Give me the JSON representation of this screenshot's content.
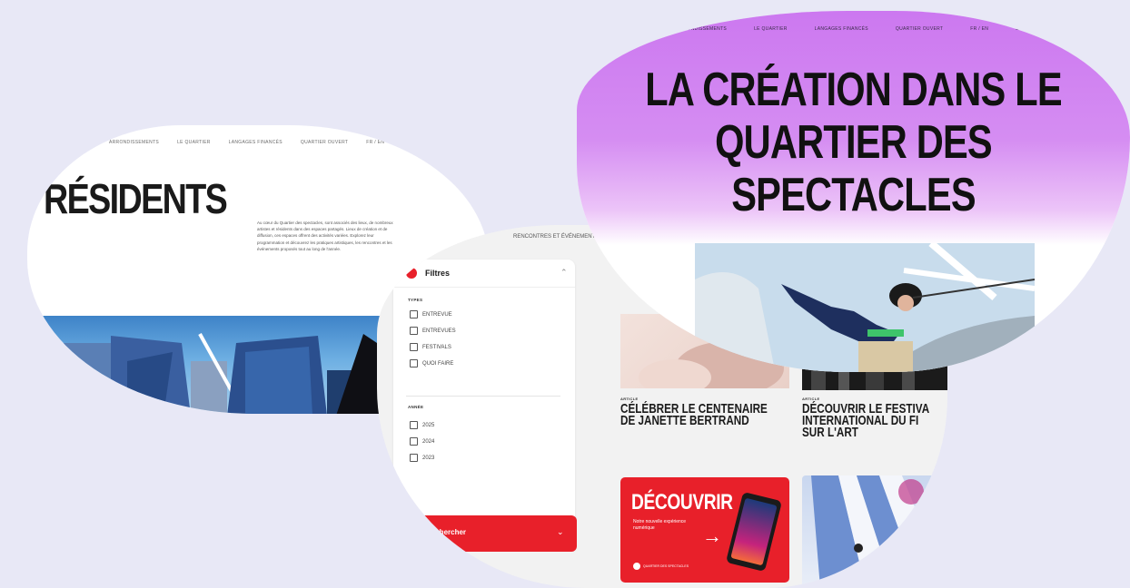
{
  "background_color": "#e8e8f6",
  "accent_color": "#e8202a",
  "hero_gradient": [
    "#cc78f0",
    "#ecc4f8"
  ],
  "left_card": {
    "nav": [
      "ARRONDISSEMENTS",
      "LE QUARTIER",
      "LANGAGES FINANCÉS",
      "QUARTIER OUVERT",
      "FR / EN"
    ],
    "title": "RÉSIDENTS",
    "intro": "Au cœur du Quartier des spectacles, sont associés des lieux, de nombreux artistes et résidents dans des espaces partagés. Lieux de création et de diffusion, ces espaces offrent des activités variées. Explorez leur programmation et découvrez les pratiques artistiques, les rencontres et les événements proposés tout au long de l'année."
  },
  "filters_card": {
    "fragment_text": "RENCONTRES ET ÉVÉNEMENTS",
    "filters_label": "Filtres",
    "type_group_title": "TYPES",
    "type_options": [
      "ENTREVUE",
      "ENTREVUES",
      "FESTIVALS",
      "QUOI FAIRE"
    ],
    "year_group_title": "ANNÉE",
    "year_options": [
      "2025",
      "2024",
      "2023"
    ],
    "search_label": "Rechercher",
    "cards": [
      {
        "kicker": "ARTICLE",
        "title_lines": [
          "CÉLÉBRER LE CENTENAIRE",
          "DE JANETTE BERTRAND"
        ]
      },
      {
        "kicker": "ARTICLE",
        "title_lines": [
          "DÉCOUVRIR LE FESTIVA",
          "INTERNATIONAL DU FI",
          "SUR L'ART"
        ]
      }
    ],
    "promo": {
      "title": "DÉCOUVRIR",
      "subtitle": "Notre nouvelle expérience numérique",
      "arrow": "→",
      "logo_text": "QUARTIER DES SPECTACLES"
    }
  },
  "right_card": {
    "nav": [
      "ARRONDISSEMENTS",
      "LE QUARTIER",
      "LANGAGES FINANCÉS",
      "QUARTIER OUVERT",
      "FR / EN",
      "EN"
    ],
    "title_lines": [
      "LA CRÉATION DANS LE",
      "QUARTIER DES",
      "SPECTACLES"
    ]
  },
  "icons": {
    "filter": "filter-icon",
    "collapse": "chevron-up-icon",
    "search_chevron": "chevron-down-icon"
  }
}
